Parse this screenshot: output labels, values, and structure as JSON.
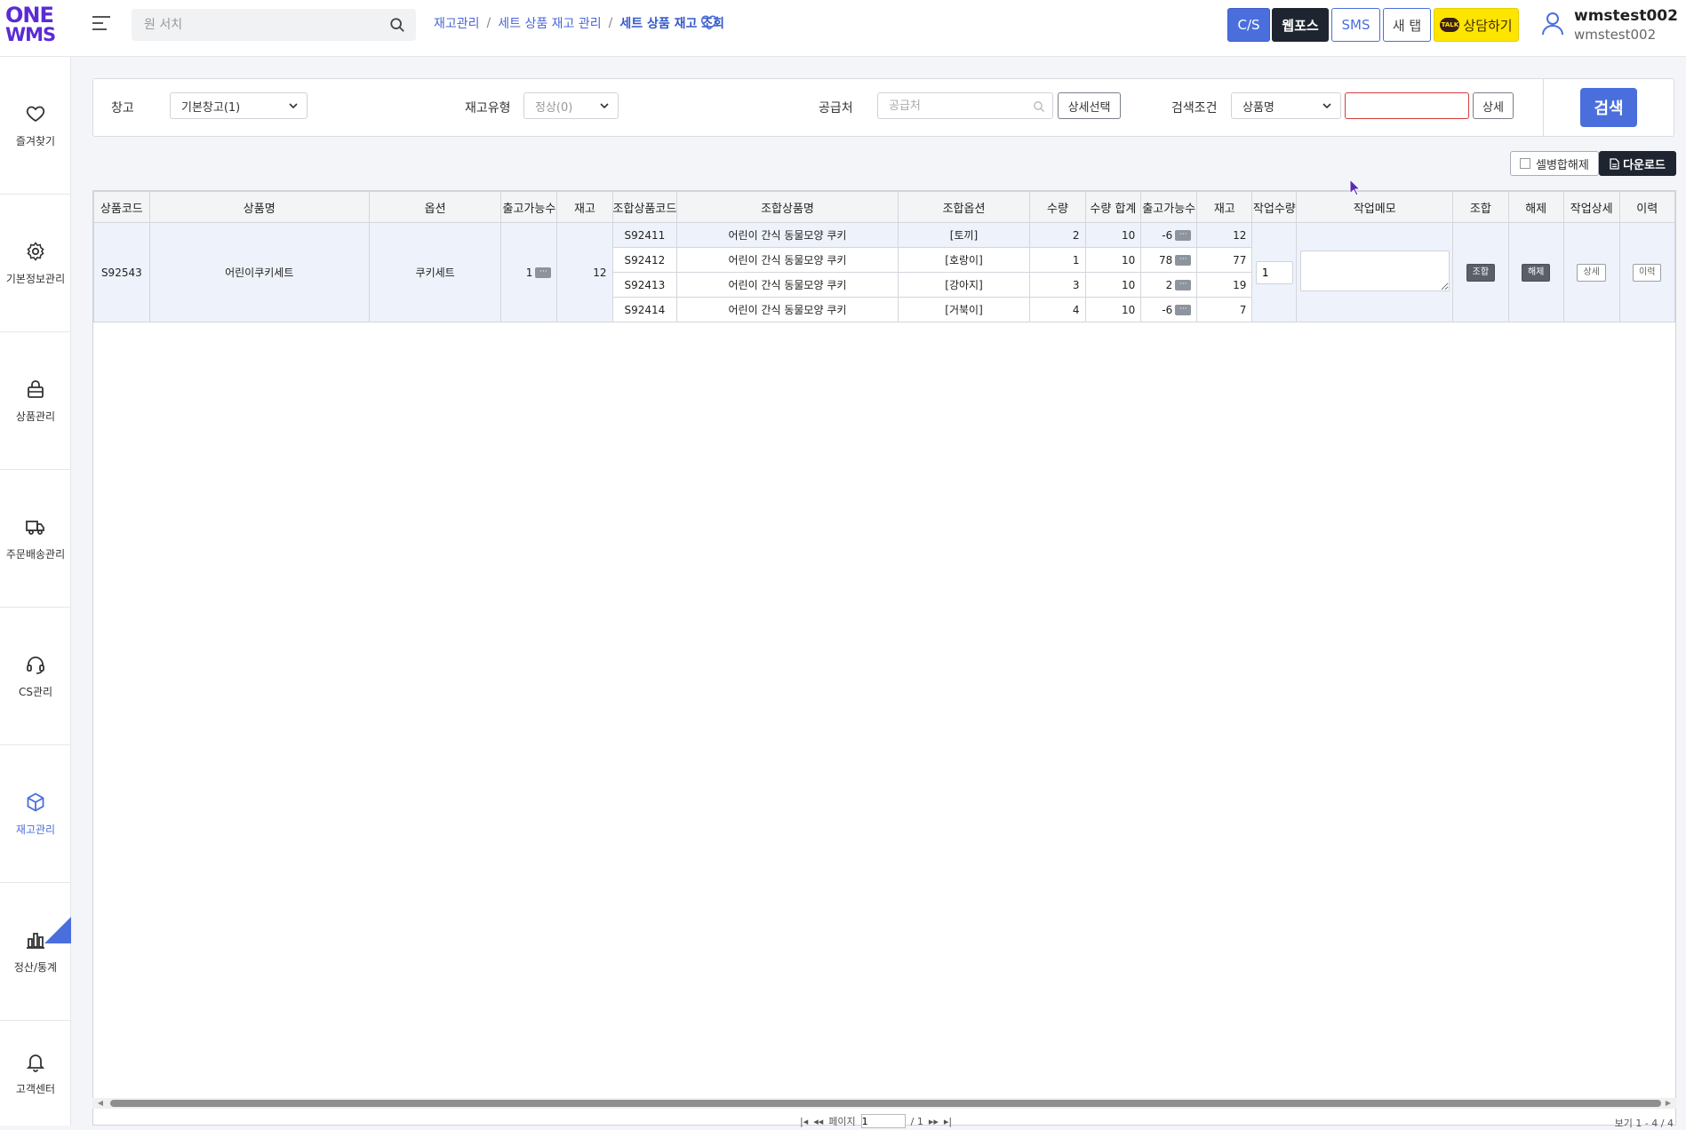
{
  "header": {
    "logo_line1": "ONE",
    "logo_line2": "WMS",
    "search_placeholder": "원 서치",
    "breadcrumb": [
      "재고관리",
      "세트 상품 재고 관리",
      "세트 상품 재고 조회"
    ],
    "buttons": {
      "cs": "C/S",
      "webpos": "웹포스",
      "sms": "SMS",
      "newtab": "새 탭",
      "talk": "상담하기",
      "talk_icon_text": "TALK"
    },
    "user": {
      "name": "wmstest002",
      "id": "wmstest002"
    }
  },
  "sidebar": {
    "items": [
      {
        "label": "즐겨찾기",
        "icon": "heart-icon"
      },
      {
        "label": "기본정보관리",
        "icon": "gear-icon"
      },
      {
        "label": "상품관리",
        "icon": "lock-box-icon"
      },
      {
        "label": "주문배송관리",
        "icon": "truck-icon"
      },
      {
        "label": "CS관리",
        "icon": "headset-icon"
      },
      {
        "label": "재고관리",
        "icon": "cube-icon",
        "active": true
      },
      {
        "label": "정산/통계",
        "icon": "bar-chart-icon"
      },
      {
        "label": "고객센터",
        "icon": "bell-icon"
      }
    ]
  },
  "filters": {
    "warehouse_label": "창고",
    "warehouse_value": "기본창고(1)",
    "stock_type_label": "재고유형",
    "stock_type_value": "정상(0)",
    "supplier_label": "공급처",
    "supplier_placeholder": "공급처",
    "detail_select_button": "상세선택",
    "search_condition_label": "검색조건",
    "search_condition_value": "상품명",
    "search_value": "",
    "detail_button": "상세",
    "search_button": "검색"
  },
  "toolbar": {
    "merge_label": "셀병합해제",
    "download_label": "다운로드"
  },
  "table": {
    "headers": [
      "상품코드",
      "상품명",
      "옵션",
      "출고가능수",
      "재고",
      "조합상품코드",
      "조합상품명",
      "조합옵션",
      "수량",
      "수량 합계",
      "출고가능수",
      "재고",
      "작업수량",
      "작업메모",
      "조합",
      "해제",
      "작업상세",
      "이력"
    ],
    "set": {
      "code": "S92543",
      "name": "어린이쿠키세트",
      "option": "쿠키세트",
      "available": "1",
      "stock": "12",
      "work_qty": "1",
      "combine_btn": "조합",
      "release_btn": "해제",
      "detail_btn": "상세",
      "history_btn": "이력"
    },
    "components": [
      {
        "code": "S92411",
        "name": "어린이 간식 동물모양 쿠키",
        "option": "[토끼]",
        "qty": "2",
        "qty_total": "10",
        "available": "-6",
        "stock": "12"
      },
      {
        "code": "S92412",
        "name": "어린이 간식 동물모양 쿠키",
        "option": "[호랑이]",
        "qty": "1",
        "qty_total": "10",
        "available": "78",
        "stock": "77"
      },
      {
        "code": "S92413",
        "name": "어린이 간식 동물모양 쿠키",
        "option": "[강아지]",
        "qty": "3",
        "qty_total": "10",
        "available": "2",
        "stock": "19"
      },
      {
        "code": "S92414",
        "name": "어린이 간식 동물모양 쿠키",
        "option": "[거북이]",
        "qty": "4",
        "qty_total": "10",
        "available": "-6",
        "stock": "7"
      }
    ],
    "dots_label": "···"
  },
  "pager": {
    "page_label": "페이지",
    "page_value": "1",
    "total_pages": "/ 1",
    "view_info": "보기 1 - 4 / 4"
  },
  "colors": {
    "accent": "#4a6fdc",
    "brand": "#5b2bd4",
    "talk": "#fee500"
  }
}
